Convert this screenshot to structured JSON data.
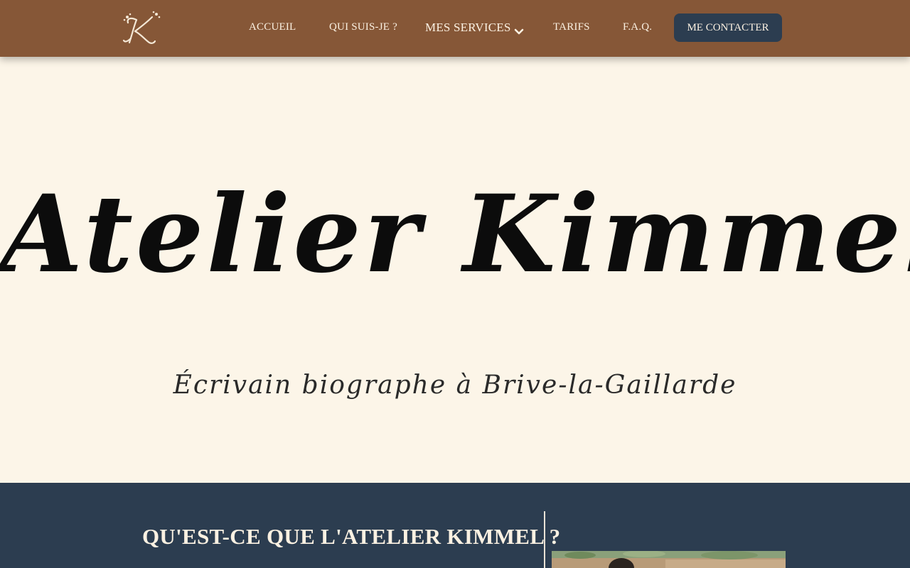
{
  "header": {
    "logo_alt": "K",
    "nav": [
      {
        "label": "ACCUEIL"
      },
      {
        "label": "QUI SUIS-JE ?"
      },
      {
        "label": "MES SERVICES"
      },
      {
        "label": "TARIFS"
      },
      {
        "label": "F.A.Q."
      }
    ],
    "contact_label": "ME CONTACTER"
  },
  "hero": {
    "title": "Atelier Kimmel",
    "subtitle": "Écrivain biographe à Brive-la-Gaillarde"
  },
  "about": {
    "title": "QU'EST-CE QUE L'ATELIER KIMMEL ?"
  },
  "colors": {
    "header_bg": "#865737",
    "hero_bg": "#fcf5e8",
    "dark_blue": "#2c3d50",
    "text_light": "#fbf1e2"
  },
  "icons": {
    "logo": "monogram-k-logo",
    "services_dropdown": "chevron-down-icon"
  }
}
